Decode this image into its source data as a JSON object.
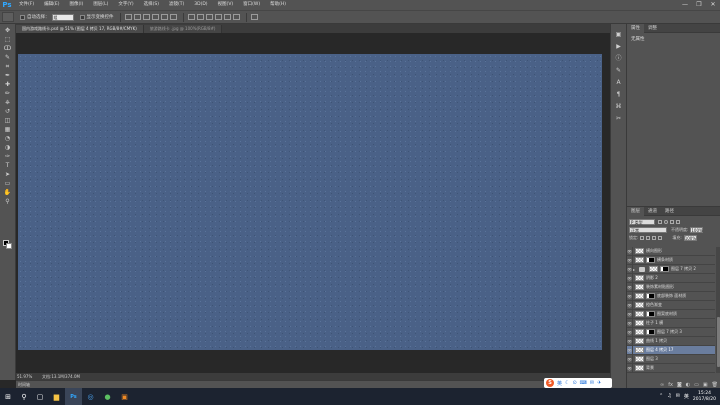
{
  "app": {
    "logo": "Ps",
    "accent": "#31a8ff"
  },
  "menu": [
    "文件(F)",
    "编辑(E)",
    "图像(I)",
    "图层(L)",
    "文字(Y)",
    "选择(S)",
    "滤镜(T)",
    "3D(D)",
    "视图(V)",
    "窗口(W)",
    "帮助(H)"
  ],
  "window_controls": {
    "minimize": "—",
    "restore": "❐",
    "close": "✕"
  },
  "options": {
    "auto_select_label": "自动选择：",
    "auto_select_value": "组",
    "show_transform_label": "显示变换控件"
  },
  "tabs": [
    {
      "label": "国内游戏路线卡.psd @ 51% (图层 4 拷贝 17, RGB/8#/CMYK)",
      "active": true
    },
    {
      "label": "旅游路线卡 .jpg @ 100%(RGB/8#)",
      "active": false
    }
  ],
  "tools": [
    "move-tool-icon",
    "marquee-tool-icon",
    "lasso-tool-icon",
    "quick-select-icon",
    "crop-tool-icon",
    "eyedropper-icon",
    "healing-brush-icon",
    "brush-tool-icon",
    "clone-stamp-icon",
    "history-brush-icon",
    "eraser-icon",
    "gradient-tool-icon",
    "blur-tool-icon",
    "dodge-tool-icon",
    "pen-tool-icon",
    "type-tool-icon",
    "path-select-icon",
    "shape-tool-icon",
    "hand-tool-icon",
    "zoom-tool-icon"
  ],
  "tool_glyphs": [
    "✥",
    "⬚",
    "ↀ",
    "✎",
    "⌗",
    "✒",
    "✚",
    "✏",
    "⎈",
    "↺",
    "◫",
    "▦",
    "◔",
    "◑",
    "✑",
    "T",
    "➤",
    "▭",
    "✋",
    "⚲"
  ],
  "canvas": {
    "color": "#4a6187"
  },
  "status": {
    "zoom": "51.97%",
    "doc": "文档:13.1M/374.0M",
    "timeline": "时间轴"
  },
  "side_icons": [
    "history-icon",
    "actions-icon",
    "info-icon",
    "brush-panel-icon",
    "character-icon",
    "paragraph-icon",
    "clone-source-icon",
    "tool-presets-icon"
  ],
  "side_glyphs": [
    "▣",
    "▶",
    "ⓘ",
    "✎",
    "A",
    "¶",
    "⌘",
    "✂"
  ],
  "properties": {
    "tabs": [
      "属性",
      "调整"
    ],
    "body": "无属性"
  },
  "layers": {
    "tabs": [
      "图层",
      "通道",
      "路径"
    ],
    "kind_filter": "P 类型",
    "blend_mode": "正常",
    "opacity_label": "不透明度:",
    "opacity_value": "100%",
    "lock_label": "锁定:",
    "fill_label": "填充:",
    "fill_value": "100%",
    "items": [
      {
        "name": "横向图形",
        "type": "pixel",
        "visible": true,
        "selected": false
      },
      {
        "name": "横条材质",
        "type": "mask",
        "visible": true,
        "selected": false
      },
      {
        "name": "图层 7 拷贝 2",
        "type": "group",
        "visible": true,
        "selected": false
      },
      {
        "name": "阴影 2",
        "type": "pixel",
        "visible": true,
        "selected": false
      },
      {
        "name": "装饰素材贴图形",
        "type": "pixel",
        "visible": true,
        "selected": false
      },
      {
        "name": "底部装饰 面材质",
        "type": "mask",
        "visible": true,
        "selected": false
      },
      {
        "name": "橙色渐变",
        "type": "pixel",
        "visible": true,
        "selected": false
      },
      {
        "name": "图案底材质",
        "type": "mask",
        "visible": true,
        "selected": false
      },
      {
        "name": "柱子 1 横",
        "type": "pixel",
        "visible": true,
        "selected": false
      },
      {
        "name": "图层 7 拷贝 3",
        "type": "mask",
        "visible": true,
        "selected": false
      },
      {
        "name": "曲线 1 拷贝",
        "type": "pixel",
        "visible": true,
        "selected": false
      },
      {
        "name": "图层 4 拷贝 17",
        "type": "pixel",
        "visible": true,
        "selected": true
      },
      {
        "name": "图层 3",
        "type": "pixel",
        "visible": true,
        "selected": false
      },
      {
        "name": "背景",
        "type": "pixel",
        "visible": true,
        "selected": false
      }
    ],
    "footer_icons": [
      "link-icon",
      "fx-icon",
      "mask-icon",
      "adjustment-icon",
      "folder-icon",
      "new-layer-icon",
      "trash-icon"
    ],
    "footer_glyphs": [
      "∞",
      "fx",
      "◙",
      "◐",
      "▭",
      "▣",
      "🗑"
    ]
  },
  "ime": {
    "logo": "S",
    "mode": "英",
    "icons": [
      "☾",
      "⊙",
      "⌨",
      "✉",
      "✈"
    ]
  },
  "taskbar": {
    "apps": [
      {
        "name": "windows-start-icon",
        "glyph": "⊞"
      },
      {
        "name": "search-icon",
        "glyph": "⚲"
      },
      {
        "name": "task-view-icon",
        "glyph": "▢"
      },
      {
        "name": "file-explorer-icon",
        "glyph": "▆"
      },
      {
        "name": "photoshop-app-icon",
        "glyph": "Ps"
      },
      {
        "name": "browser-app-icon",
        "glyph": "◎"
      },
      {
        "name": "app-green-icon",
        "glyph": "●"
      },
      {
        "name": "app-orange-icon",
        "glyph": "▣"
      }
    ],
    "tray_glyphs": [
      "⌃",
      "♫",
      "✉",
      "英"
    ],
    "time": "15:24",
    "date": "2017/8/20"
  }
}
